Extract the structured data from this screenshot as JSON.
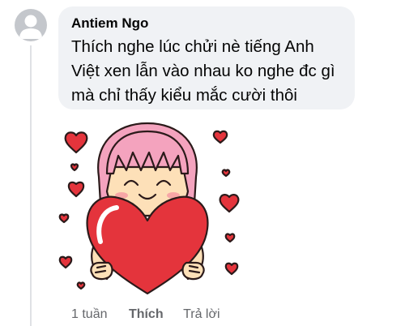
{
  "comment": {
    "author": "Antiem Ngo",
    "text": "Thích nghe lúc chửi nè tiếng Anh Việt xen lẫn vào nhau ko nghe đc gì mà chỉ thấy kiểu mắc cười thôi",
    "sticker": {
      "icon": "girl-hugging-heart-sticker",
      "colors": {
        "heart": "#e4343c",
        "hair": "#f4a3be",
        "skin": "#fde0b8",
        "outline": "#2b1a1a"
      }
    },
    "actions": {
      "timestamp": "1 tuần",
      "like_label": "Thích",
      "reply_label": "Trả lời"
    }
  },
  "colors": {
    "bubble_bg": "#f0f2f5",
    "text": "#050505",
    "secondary_text": "#65676b",
    "avatar_bg": "#c4c7cc",
    "thread_line": "#dfe1e5"
  }
}
